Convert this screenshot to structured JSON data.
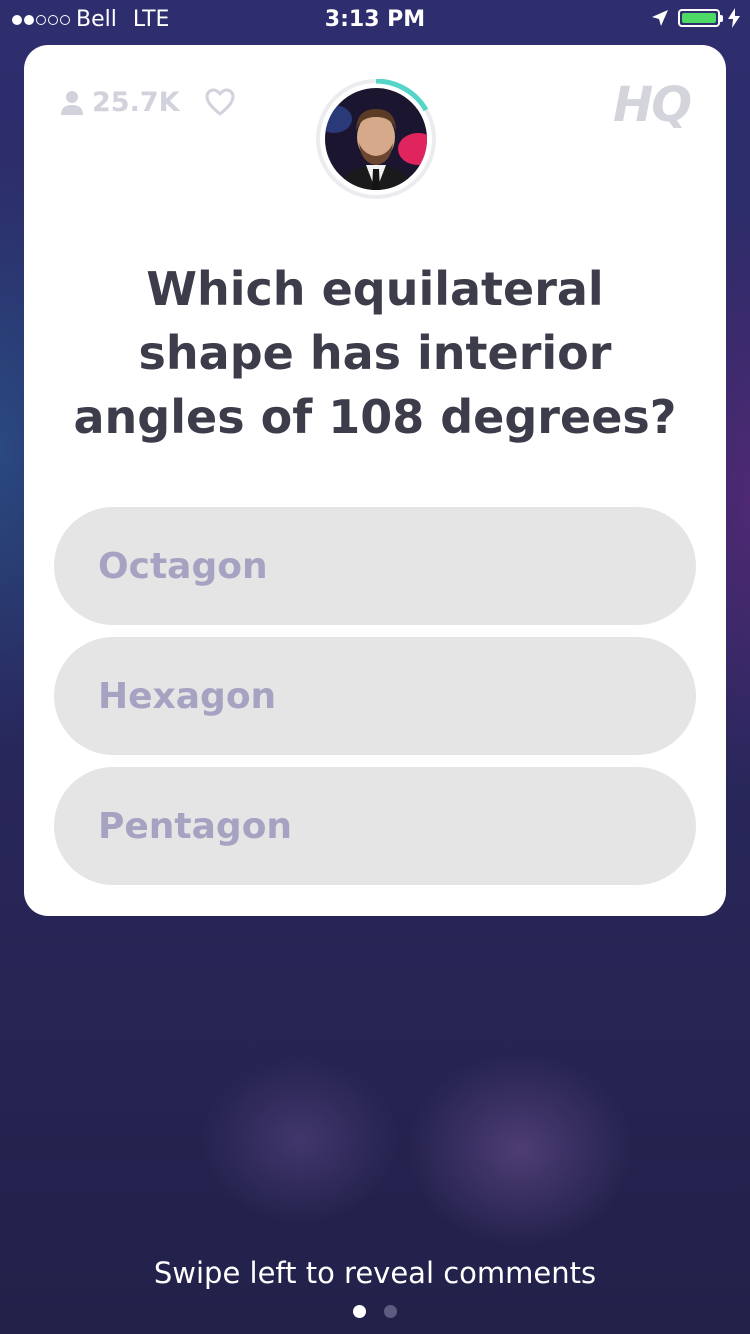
{
  "status_bar": {
    "carrier": "Bell",
    "network": "LTE",
    "time": "3:13 PM",
    "signal_filled": 2,
    "signal_total": 5,
    "battery_color": "#4cd964"
  },
  "card": {
    "viewer_count": "25.7K",
    "logo_text": "HQ",
    "question": "Which equilateral shape has interior angles of 108 degrees?",
    "answers": [
      {
        "label": "Octagon"
      },
      {
        "label": "Hexagon"
      },
      {
        "label": "Pentagon"
      }
    ]
  },
  "footer": {
    "hint": "Swipe left to reveal comments",
    "pages": 2,
    "current_page": 1
  },
  "colors": {
    "timer_ring": "#55d5c8",
    "answer_bg": "#e5e5e5",
    "answer_text": "#a6a3c2",
    "question_text": "#3c3c4a"
  }
}
